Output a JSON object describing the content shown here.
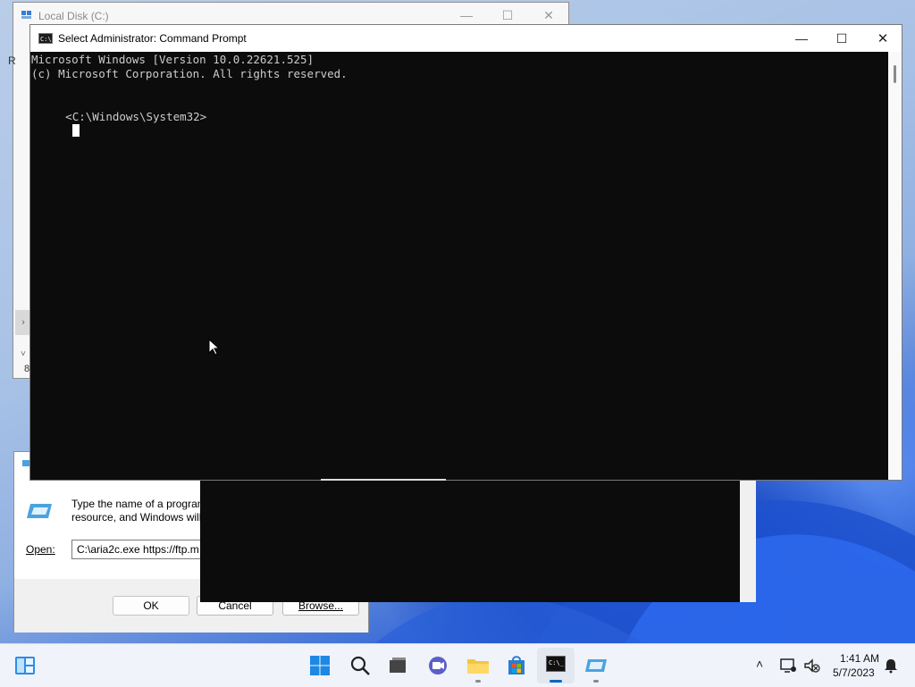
{
  "explorer": {
    "title": "Local Disk (C:)",
    "partial_letters": [
      "R",
      "8"
    ]
  },
  "cmd": {
    "title": "Select Administrator: Command Prompt",
    "lines": [
      "Microsoft Windows [Version 10.0.22621.525]",
      "(c) Microsoft Corporation. All rights reserved.",
      "",
      "C:\\Windows\\System32>"
    ],
    "prefix_char": "<"
  },
  "run_dialog": {
    "description_line1": "Type the name of a program",
    "description_line2": "resource, and Windows will",
    "open_label": "Open:",
    "open_value": "C:\\aria2c.exe https://ftp.m",
    "ok_label": "OK",
    "cancel_label": "Cancel",
    "browse_label": "Browse..."
  },
  "taskbar": {
    "time": "1:41 AM",
    "date": "5/7/2023",
    "accent_color": "#0067c0"
  },
  "colors": {
    "console_bg": "#0c0c0c",
    "console_fg": "#cccccc"
  }
}
